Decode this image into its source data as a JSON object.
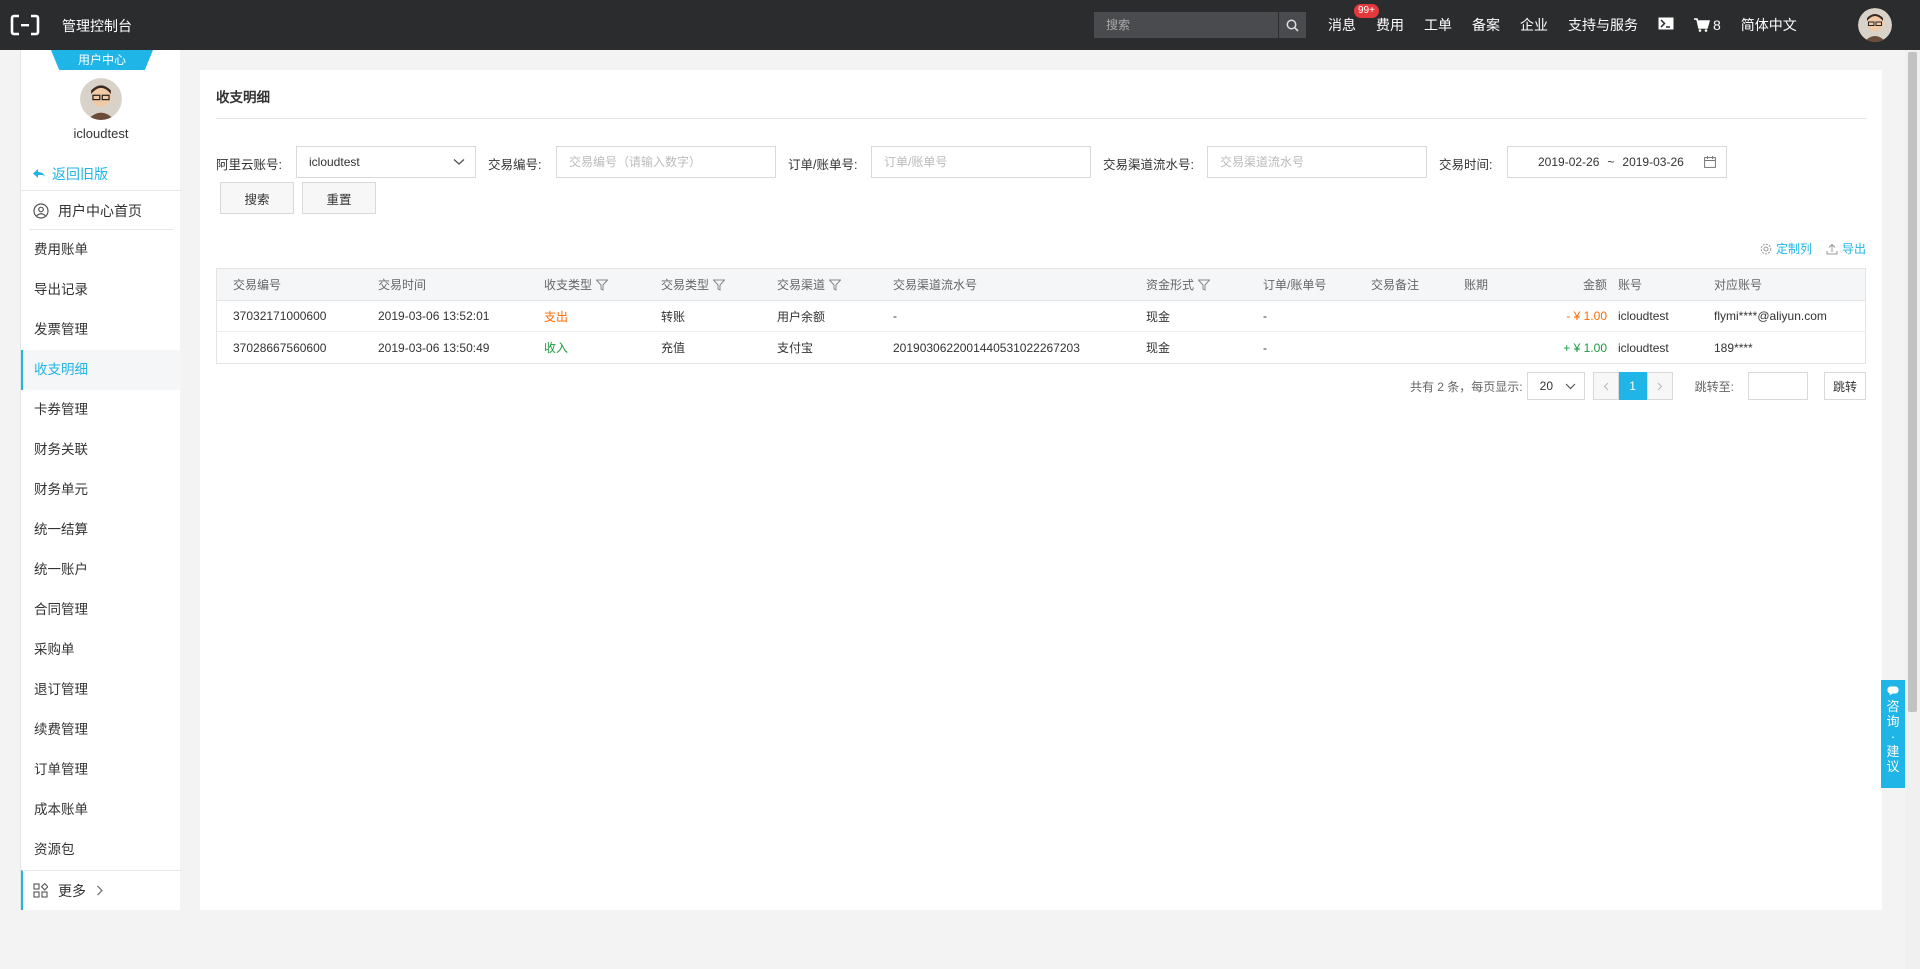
{
  "topbar": {
    "brand": "管理控制台",
    "search_placeholder": "搜索",
    "nav": {
      "messages": "消息",
      "messages_badge": "99+",
      "fees": "费用",
      "tickets": "工单",
      "icp": "备案",
      "enterprise": "企业",
      "support": "支持与服务",
      "cart_count": "8",
      "language": "简体中文"
    }
  },
  "sidebar": {
    "tag": "用户中心",
    "username": "icloudtest",
    "back_old": "返回旧版",
    "home": "用户中心首页",
    "items": [
      {
        "label": "费用账单"
      },
      {
        "label": "导出记录"
      },
      {
        "label": "发票管理"
      },
      {
        "label": "收支明细",
        "active": true
      },
      {
        "label": "卡券管理"
      },
      {
        "label": "财务关联"
      },
      {
        "label": "财务单元"
      },
      {
        "label": "统一结算"
      },
      {
        "label": "统一账户"
      },
      {
        "label": "合同管理"
      },
      {
        "label": "采购单"
      },
      {
        "label": "退订管理"
      },
      {
        "label": "续费管理"
      },
      {
        "label": "订单管理"
      },
      {
        "label": "成本账单"
      },
      {
        "label": "资源包"
      }
    ],
    "more": "更多"
  },
  "page": {
    "title": "收支明细"
  },
  "filters": {
    "account_label": "阿里云账号:",
    "account_value": "icloudtest",
    "txn_no_label": "交易编号:",
    "txn_no_placeholder": "交易编号（请输入数字）",
    "order_label": "订单/账单号:",
    "order_placeholder": "订单/账单号",
    "channel_label": "交易渠道流水号:",
    "channel_placeholder": "交易渠道流水号",
    "time_label": "交易时间:",
    "date_start": "2019-02-26",
    "date_sep": "~",
    "date_end": "2019-03-26",
    "search_button": "搜索",
    "reset_button": "重置"
  },
  "tools": {
    "custom_columns": "定制列",
    "export": "导出"
  },
  "table": {
    "headers": {
      "txn_no": "交易编号",
      "time": "交易时间",
      "io_type": "收支类型",
      "txn_type": "交易类型",
      "channel": "交易渠道",
      "channel_serial": "交易渠道流水号",
      "fund_form": "资金形式",
      "order_no": "订单/账单号",
      "remark": "交易备注",
      "period": "账期",
      "amount": "金额",
      "account": "账号",
      "counterpart": "对应账号"
    },
    "rows": [
      {
        "txn_no": "37032171000600",
        "time": "2019-03-06 13:52:01",
        "io_type": "支出",
        "txn_type": "转账",
        "channel": "用户余额",
        "channel_serial": "-",
        "fund_form": "现金",
        "order_no": "-",
        "remark": "",
        "period": "",
        "amount": "- ¥ 1.00",
        "account": "icloudtest",
        "counterpart": "flymi****@aliyun.com"
      },
      {
        "txn_no": "37028667560600",
        "time": "2019-03-06 13:50:49",
        "io_type": "收入",
        "txn_type": "充值",
        "channel": "支付宝",
        "channel_serial": "2019030622001440531022267203",
        "fund_form": "现金",
        "order_no": "-",
        "remark": "",
        "period": "",
        "amount": "+ ¥ 1.00",
        "account": "icloudtest",
        "counterpart": "189****"
      }
    ]
  },
  "pagination": {
    "summary": "共有 2 条，每页显示:",
    "page_size": "20",
    "current_page": "1",
    "jump_label": "跳转至:",
    "jump_button": "跳转"
  },
  "float_button": {
    "chars": [
      "咨",
      "询",
      "·",
      "建",
      "议"
    ]
  },
  "colors": {
    "accent": "#1fb5e6",
    "expense": "#ff6a00",
    "income": "#1a9c3c",
    "topbar": "#2b2c2e"
  }
}
